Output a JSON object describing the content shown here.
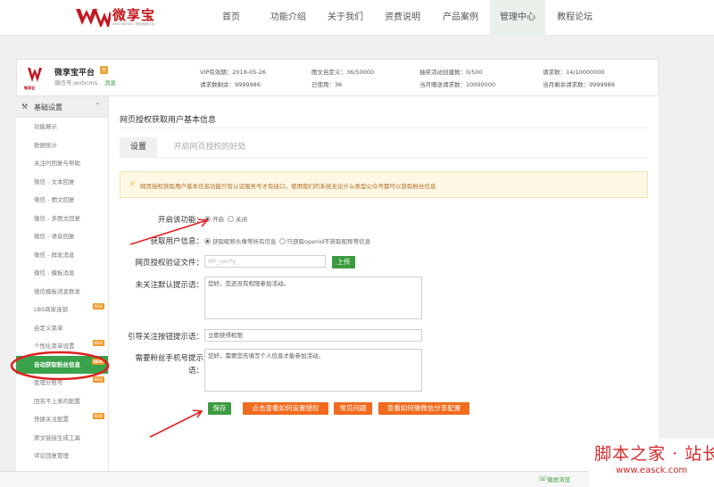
{
  "brand": {
    "name": "微享宝",
    "tagline": "WXSHAREBAO 微信营销平台",
    "color": "#c1181f"
  },
  "nav": {
    "items": [
      {
        "label": "首页"
      },
      {
        "label": "功能介绍"
      },
      {
        "label": "关于我们"
      },
      {
        "label": "资费说明"
      },
      {
        "label": "产品案例"
      },
      {
        "label": "管理中心"
      },
      {
        "label": "教程论坛"
      }
    ],
    "active": "管理中心"
  },
  "account": {
    "logo_caption": "微享宝",
    "name": "微享宝平台",
    "badge": "V",
    "id_label": "微信号:wxbcms",
    "tag": "消息",
    "stats": [
      "VIP有效期：2018-05-26",
      "请求数剩余：9999986",
      "图文自定义：36/50000",
      "已使用：36",
      "抽奖活动创建数：0/500",
      "当月赠送请求数：10000000",
      "请求数：14/10000000",
      "当月剩余请求数：9999986"
    ]
  },
  "sidebar": {
    "section": "基础设置",
    "items": [
      {
        "label": "功能展示",
        "new": false
      },
      {
        "label": "数据统计",
        "new": false
      },
      {
        "label": "关注时回复与帮助",
        "new": false
      },
      {
        "label": "微信 - 文本回复",
        "new": false
      },
      {
        "label": "微信 - 图文回复",
        "new": false
      },
      {
        "label": "微信 - 多图文回复",
        "new": false
      },
      {
        "label": "微信 - 语音回复",
        "new": false
      },
      {
        "label": "微信 - 群发消息",
        "new": false
      },
      {
        "label": "微信 - 模板消息",
        "new": false
      },
      {
        "label": "微信模板消息群发",
        "new": false
      },
      {
        "label": "LBS商家连锁",
        "new": true
      },
      {
        "label": "自定义菜单",
        "new": false
      },
      {
        "label": "个性化菜单设置",
        "new": true
      },
      {
        "label": "自动获取粉丝信息",
        "new": true,
        "active": true
      },
      {
        "label": "管理分账号",
        "new": true
      },
      {
        "label": "回答不上来的配置",
        "new": false
      },
      {
        "label": "快捷关注配置",
        "new": true
      },
      {
        "label": "原文链接生成工具",
        "new": false
      },
      {
        "label": "评论回复管理",
        "new": false
      }
    ],
    "new_label": "NEW"
  },
  "main": {
    "title": "网页授权获取用户基本信息",
    "tabs": [
      {
        "label": "设置"
      },
      {
        "label": "开启网页授权的好处"
      }
    ],
    "notice": "网页授权获取用户基本信息功能只有认证服务号才有接口，使用我们的系统无论什么类型公众号都可以获取粉丝信息",
    "form": {
      "enable_label": "开启该功能：",
      "enable_on": "开启",
      "enable_off": "关闭",
      "userinfo_label": "获取用户信息：",
      "userinfo_opt1": "获取昵称头像等所有信息",
      "userinfo_opt2": "只获取openid不获取昵称等信息",
      "verify_label": "网页授权验证文件：",
      "verify_value": "MP_verify_",
      "upload_label": "上传",
      "unfollow_label": "未关注默认提示语：",
      "unfollow_value": "您好，您还没有权限参加活动。",
      "guide_label": "引导关注按钮提示语：",
      "guide_value": "立即获得权限",
      "phone_label_1": "需要粉丝手机号提示",
      "phone_label_2": "语：",
      "phone_value": "您好，需要您先填写个人信息才能参加活动。"
    },
    "buttons": {
      "save": "保存",
      "howto": "点击查看如何设置授权",
      "faq": "常见问题",
      "share": "查看如何做微信分享配置"
    }
  },
  "bottombar": {
    "label": "微屏浏览"
  },
  "watermark": {
    "cn": "脚本之家 · 站长站",
    "url": "www.easck.com"
  }
}
